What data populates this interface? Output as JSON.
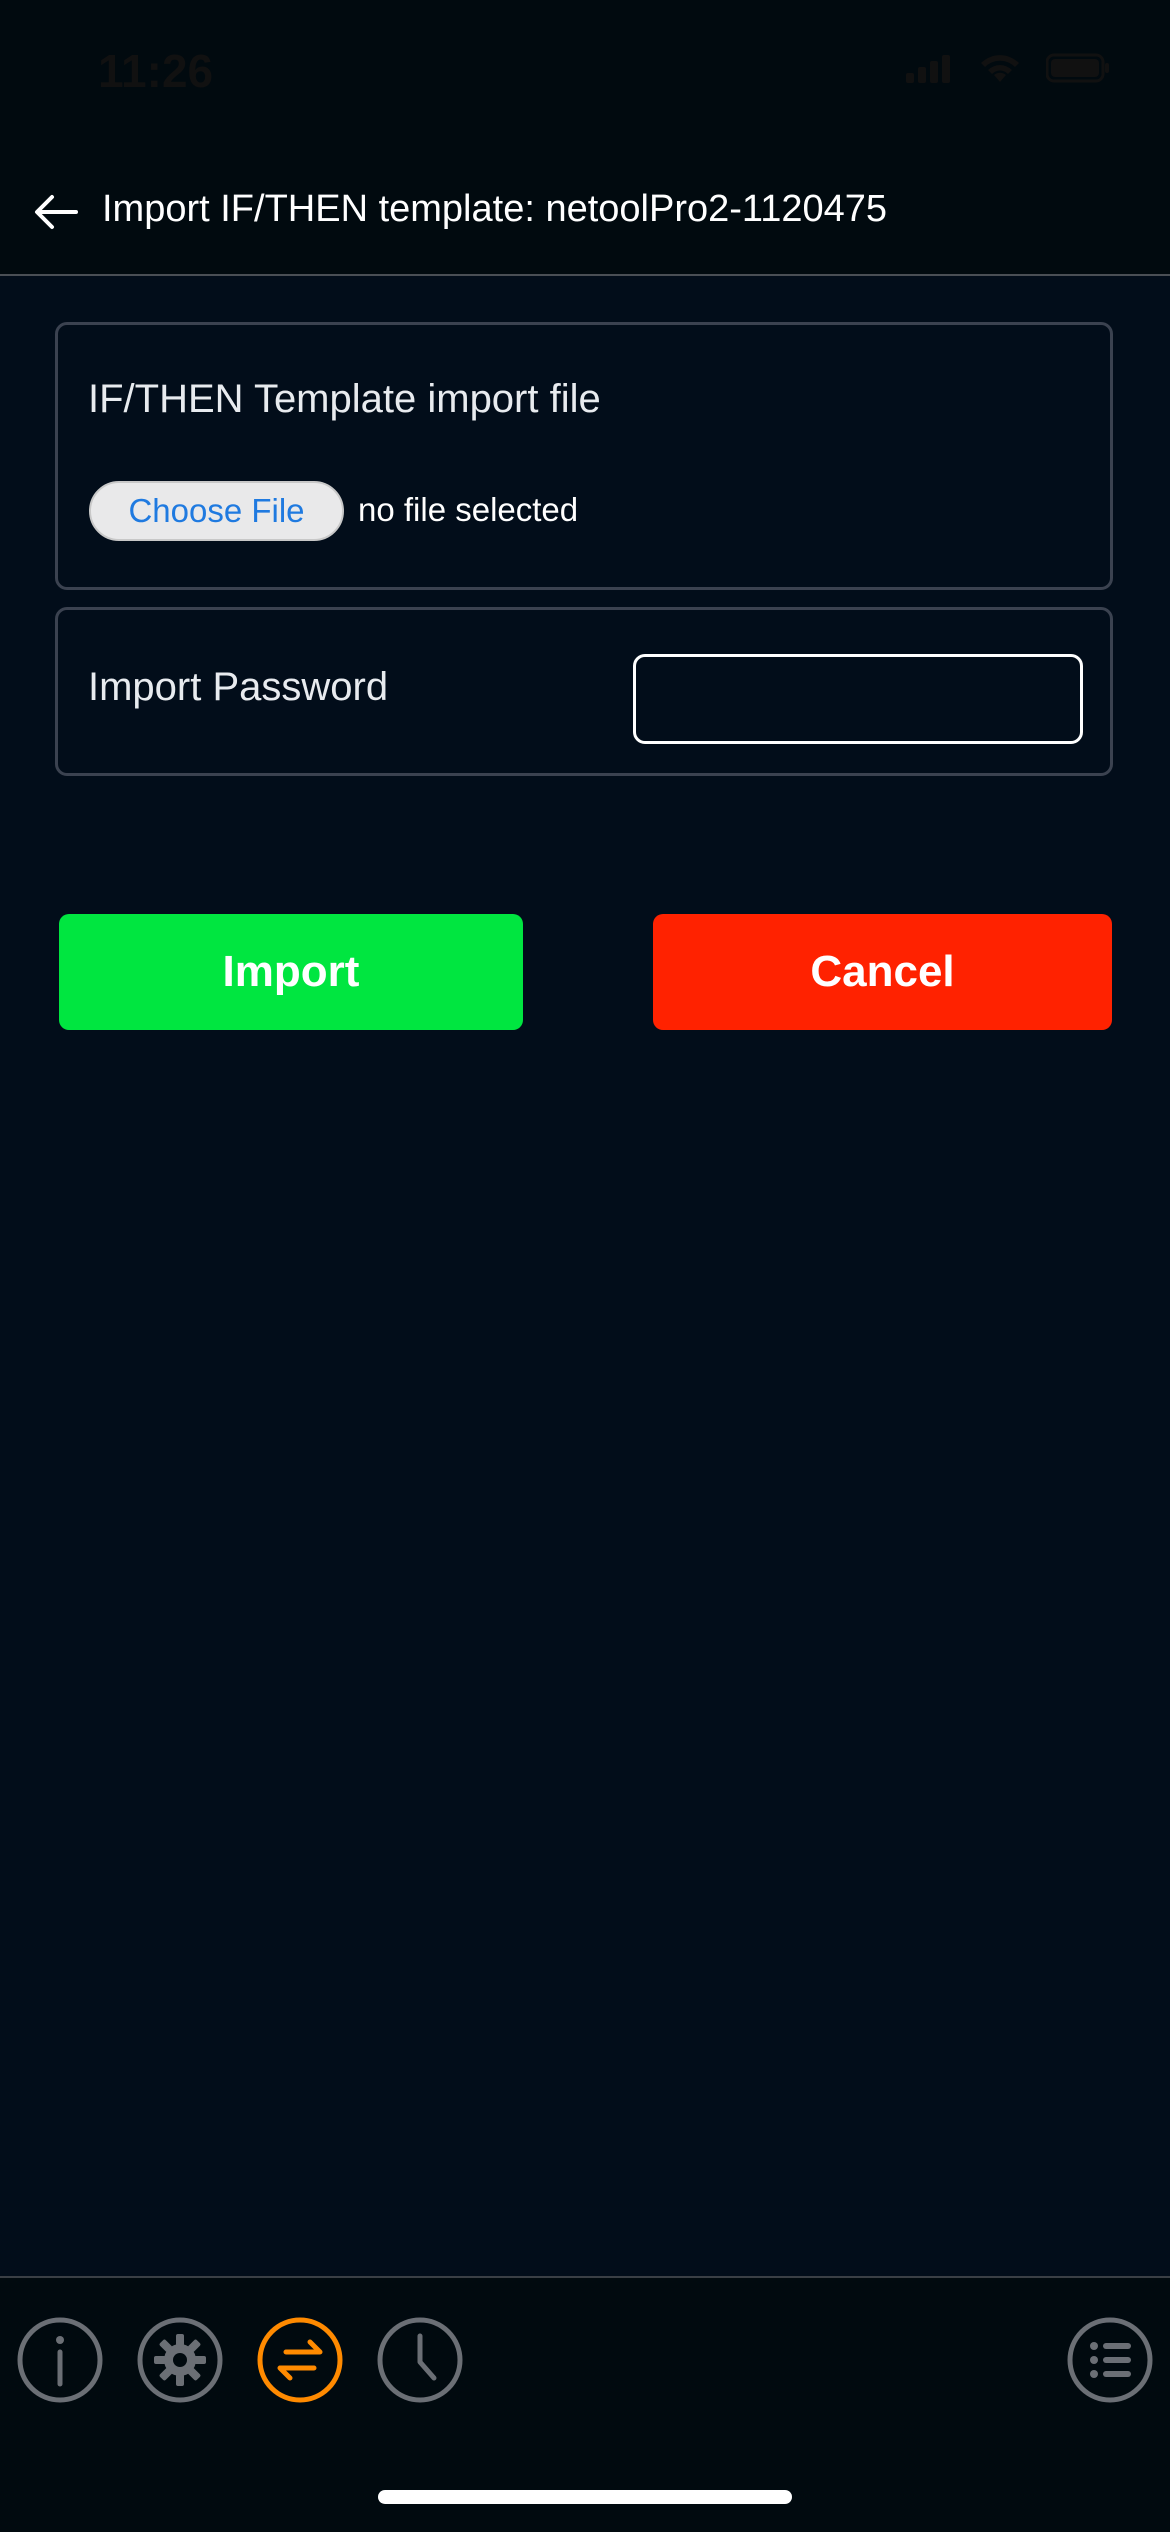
{
  "status_bar": {
    "time": "11:26"
  },
  "header": {
    "title": "Import IF/THEN template: netoolPro2-1120475",
    "back_icon": "arrow-left-icon"
  },
  "file_card": {
    "label": "IF/THEN Template import file",
    "choose_file_label": "Choose File",
    "file_status": "no file selected"
  },
  "password_card": {
    "label": "Import Password",
    "value": ""
  },
  "actions": {
    "import_label": "Import",
    "cancel_label": "Cancel"
  },
  "bottom_nav": {
    "items": [
      {
        "icon": "info-icon",
        "active": false
      },
      {
        "icon": "gear-icon",
        "active": false
      },
      {
        "icon": "exchange-arrows-icon",
        "active": true
      },
      {
        "icon": "clock-icon",
        "active": false
      },
      {
        "icon": "list-menu-icon",
        "active": false
      }
    ]
  },
  "colors": {
    "background": "#020d1a",
    "import_button": "#00e640",
    "cancel_button": "#ff2200",
    "nav_active": "#ff8a00",
    "nav_inactive": "#6b6f75",
    "link_blue": "#1f7ae0"
  }
}
